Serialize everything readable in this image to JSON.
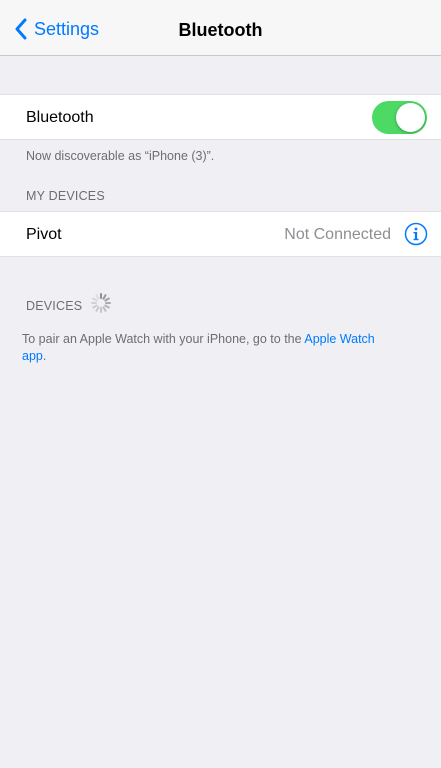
{
  "navbar": {
    "back_label": "Settings",
    "title": "Bluetooth"
  },
  "bluetooth_cell": {
    "label": "Bluetooth",
    "toggle_on": true,
    "toggle_color": "#4cd964"
  },
  "discoverable_text": "Now discoverable as “iPhone (3)”.",
  "my_devices": {
    "header": "MY DEVICES",
    "items": [
      {
        "name": "Pivot",
        "status": "Not Connected",
        "icon": "info-icon"
      }
    ]
  },
  "devices": {
    "header": "DEVICES",
    "spinner_icon": "loading-spinner-icon"
  },
  "pair_text": {
    "prefix": "To pair an Apple Watch with your iPhone, go to the ",
    "link_part1": "Apple Watch",
    "link_part2": "app",
    "suffix": "."
  },
  "colors": {
    "accent": "#007aff",
    "background": "#efeff4",
    "secondary_text": "#6d6d72"
  }
}
